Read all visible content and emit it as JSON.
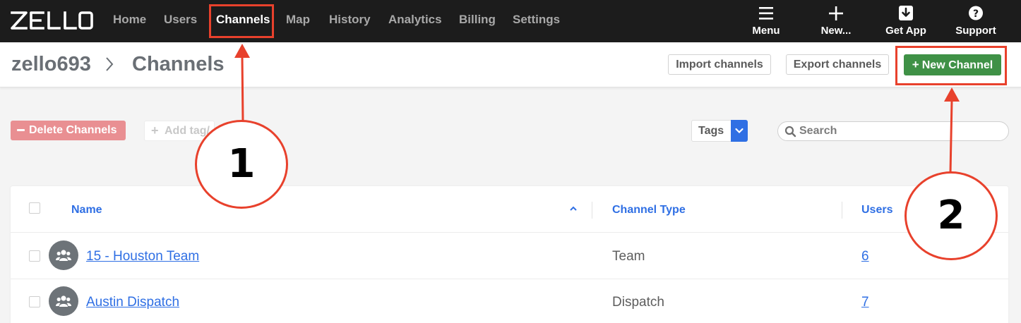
{
  "brand": {
    "logo_text": "ZELLO"
  },
  "nav": {
    "items": [
      {
        "label": "Home"
      },
      {
        "label": "Users"
      },
      {
        "label": "Channels"
      },
      {
        "label": "Map"
      },
      {
        "label": "History"
      },
      {
        "label": "Analytics"
      },
      {
        "label": "Billing"
      },
      {
        "label": "Settings"
      }
    ],
    "active": "Channels"
  },
  "top_actions": {
    "menu": {
      "label": "Menu",
      "icon": "hamburger-icon"
    },
    "new": {
      "label": "New...",
      "icon": "plus-icon"
    },
    "get_app": {
      "label": "Get App",
      "icon": "download-icon"
    },
    "support": {
      "label": "Support",
      "icon": "help-icon"
    }
  },
  "header": {
    "account": "zello693",
    "page_title": "Channels",
    "import_label": "Import channels",
    "export_label": "Export channels",
    "new_channel_label": "New Channel"
  },
  "toolbar": {
    "delete_label": "Delete Channels",
    "add_tag_placeholder": "Add tag/",
    "tags_label": "Tags",
    "search_placeholder": "Search"
  },
  "table": {
    "columns": [
      "Name",
      "Channel Type",
      "Users"
    ],
    "rows": [
      {
        "name": "15 - Houston Team",
        "type": "Team",
        "users": "6"
      },
      {
        "name": "Austin Dispatch",
        "type": "Dispatch",
        "users": "7"
      }
    ]
  },
  "annotations": {
    "step1": "1",
    "step2": "2"
  },
  "colors": {
    "topbar": "#1c1c1c",
    "accent_blue": "#2f6fe4",
    "primary_green": "#3f9146",
    "danger_light": "#e98f92",
    "annotation_red": "#e8412c"
  }
}
